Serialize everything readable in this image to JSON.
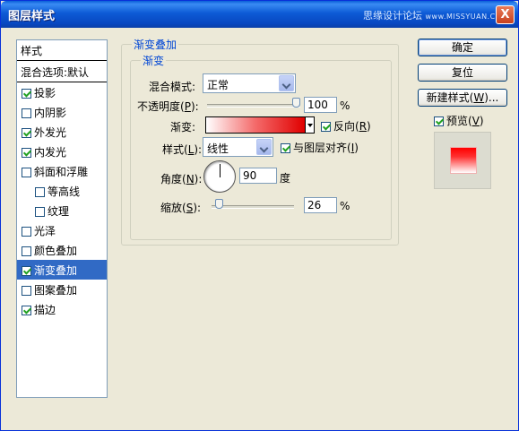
{
  "window": {
    "title": "图层样式",
    "watermark_main": "思缘设计论坛",
    "watermark_url": "www.MISSYUAN.COM",
    "close_label": "X"
  },
  "style_list": {
    "header": "样式",
    "blend_default": "混合选项:默认",
    "items": [
      {
        "label": "投影",
        "checked": true
      },
      {
        "label": "内阴影",
        "checked": false
      },
      {
        "label": "外发光",
        "checked": true
      },
      {
        "label": "内发光",
        "checked": true
      },
      {
        "label": "斜面和浮雕",
        "checked": false
      },
      {
        "label": "等高线",
        "checked": false
      },
      {
        "label": "纹理",
        "checked": false
      },
      {
        "label": "光泽",
        "checked": false
      },
      {
        "label": "颜色叠加",
        "checked": false
      },
      {
        "label": "渐变叠加",
        "checked": true
      },
      {
        "label": "图案叠加",
        "checked": false
      },
      {
        "label": "描边",
        "checked": true
      }
    ]
  },
  "panel": {
    "group_title": "渐变叠加",
    "sub_title": "渐变",
    "blend_mode_label": "混合模式:",
    "blend_mode_value": "正常",
    "opacity_label_pre": "不透明度(",
    "opacity_key": "P",
    "opacity_label_post": "):",
    "opacity_value": "100",
    "opacity_fraction": 1.0,
    "percent": "%",
    "gradient_label": "渐变:",
    "reverse_pre": "反向(",
    "reverse_key": "R",
    "reverse_post": ")",
    "reverse_checked": true,
    "style_label_pre": "样式(",
    "style_key": "L",
    "style_label_post": "):",
    "style_value": "线性",
    "align_pre": "与图层对齐(",
    "align_key": "I",
    "align_post": ")",
    "align_checked": true,
    "angle_label_pre": "角度(",
    "angle_key": "N",
    "angle_label_post": "):",
    "angle_value": "90",
    "degree": "度",
    "scale_label_pre": "缩放(",
    "scale_key": "S",
    "scale_label_post": "):",
    "scale_value": "26",
    "scale_fraction": 0.1
  },
  "buttons": {
    "ok": "确定",
    "reset": "复位",
    "new_style_pre": "新建样式(",
    "new_style_key": "W",
    "new_style_post": ")...",
    "preview_pre": "预览(",
    "preview_key": "V",
    "preview_post": ")",
    "preview_checked": true
  },
  "colors": {
    "gradient_start": "#ffffff",
    "gradient_end": "#e00000",
    "selection": "#316ac5"
  }
}
